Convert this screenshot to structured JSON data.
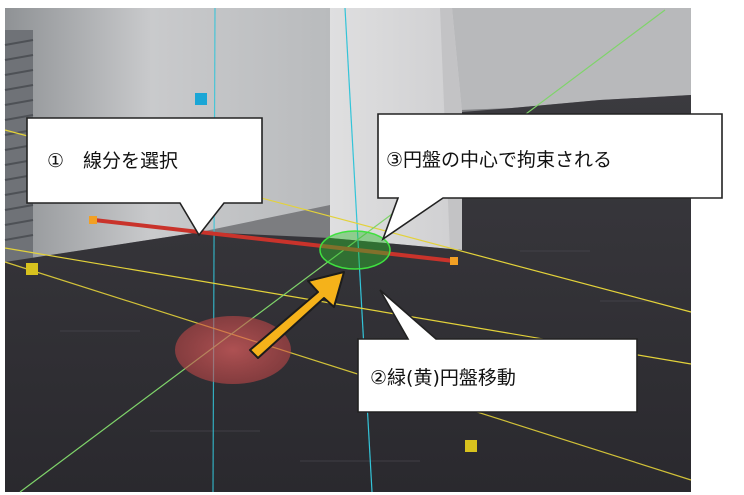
{
  "callouts": {
    "select_segment": "①　線分を選択",
    "constrained": "③円盤の中心で拘束される",
    "move_disc": "②緑(黄)円盤移動"
  },
  "colors": {
    "segment": "#c9332b",
    "green_disc": "#2dbb2d",
    "red_disc": "#d94a4a",
    "axis_cyan": "#33c4d8",
    "axis_yellow": "#e3d23a",
    "axis_green": "#7fd46a",
    "arrow": "#f5b21a",
    "handle_yellow": "#d8c21e",
    "handle_orange": "#f2a024",
    "handle_cyan": "#1aa6d6"
  },
  "icons": {
    "arrow": "arrow-icon",
    "handles": "handle-icon"
  }
}
